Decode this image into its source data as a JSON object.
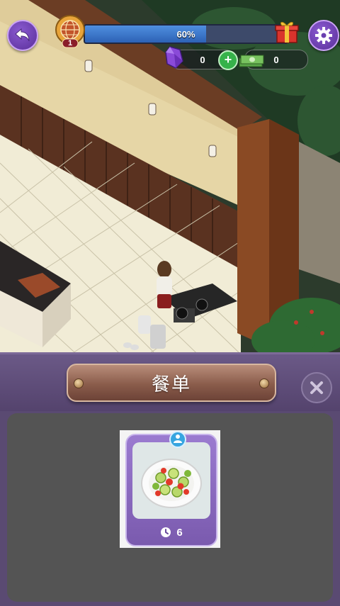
{
  "hud": {
    "level": "1",
    "progress_text": "60%",
    "progress_fraction": 0.6,
    "gems": "0",
    "cash": "0",
    "add_gem_label": "+",
    "icons": {
      "back": "back-arrow-icon",
      "settings": "gear-icon",
      "gift": "gift-icon",
      "gem": "purple-gem-icon",
      "cash": "cash-stack-icon",
      "level": "globe-badge-icon"
    }
  },
  "menu": {
    "title": "餐单",
    "close_icon": "close-icon",
    "dishes": [
      {
        "name_icon": "salad-icon",
        "time": "6",
        "time_icon": "clock-icon",
        "badge_icon": "customer-icon"
      }
    ]
  },
  "colors": {
    "panel": "#5a4a72",
    "banner": "#8a5c4b",
    "progress_fill": "#3a75cc",
    "dish_card": "#8a6bc0"
  }
}
